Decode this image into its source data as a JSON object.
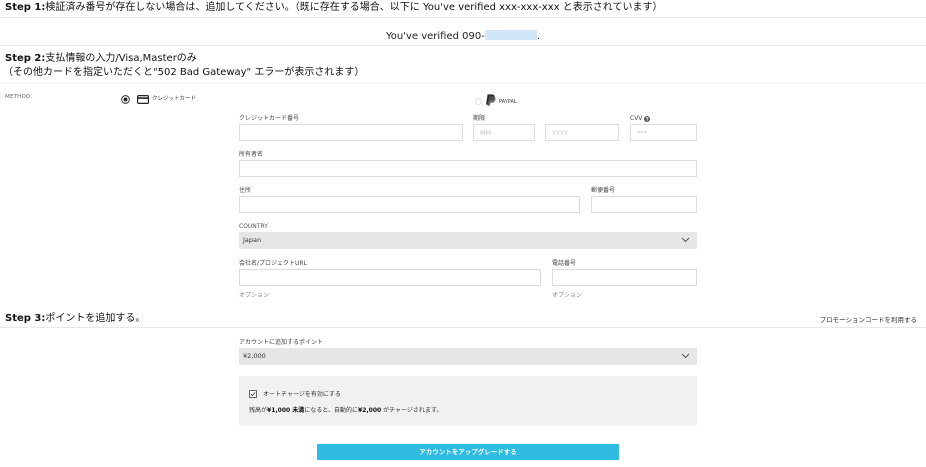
{
  "step1": {
    "label": "Step 1:",
    "text": "検証済み番号が存在しない場合は、追加してください。（既に存在する場合、以下に You've verified xxx-xxx-xxx と表示されています）"
  },
  "verified": {
    "text": "You've verified 090-",
    "suffix": "."
  },
  "step2": {
    "label": "Step 2:",
    "text": "支払情報の入力/Visa,Masterのみ",
    "note": "（その他カードを指定いただくと\"502 Bad Gateway\" エラーが表示されます）"
  },
  "method": {
    "label": "METHOD",
    "options": [
      {
        "label": "クレジットカード",
        "icon": "credit-card-icon",
        "selected": true
      },
      {
        "label": "PAYPAL",
        "icon": "paypal-icon",
        "selected": false
      }
    ]
  },
  "card_form": {
    "card_number": {
      "label": "クレジットカード番号"
    },
    "expiry": {
      "label": "期限",
      "month_placeholder": "MM",
      "year_placeholder": "YYYY"
    },
    "cvv": {
      "label": "CVV",
      "placeholder": "***",
      "help_icon": "help-icon"
    },
    "holder_name": {
      "label": "所有者名"
    },
    "address": {
      "label": "住所"
    },
    "postal_code": {
      "label": "郵便番号"
    },
    "country": {
      "label": "COUNTRY",
      "value": "Japan"
    },
    "company": {
      "label": "会社名/プロジェクトURL",
      "hint": "オプション"
    },
    "phone": {
      "label": "電話番号",
      "hint": "オプション"
    }
  },
  "step3": {
    "label": "Step 3:",
    "text": "ポイントを追加する。",
    "promo_link": "プロモーションコードを利用する"
  },
  "points": {
    "label": "アカウントに追加するポイント",
    "value": "¥2,000"
  },
  "autocharge": {
    "label": "オートチャージを有効にする",
    "checked": true,
    "description": {
      "prefix": "残高が",
      "threshold": "¥1,000 未満",
      "middle": "になると、自動的に",
      "amount": "¥2,000",
      "suffix": " がチャージされます。"
    }
  },
  "upgrade_button": {
    "label": "アカウントをアップグレードする"
  },
  "colors": {
    "accent": "#30bbe2",
    "redaction": "#cfe7f8",
    "select_bg": "#e6e6e6",
    "panel_bg": "#f1f1f1"
  }
}
